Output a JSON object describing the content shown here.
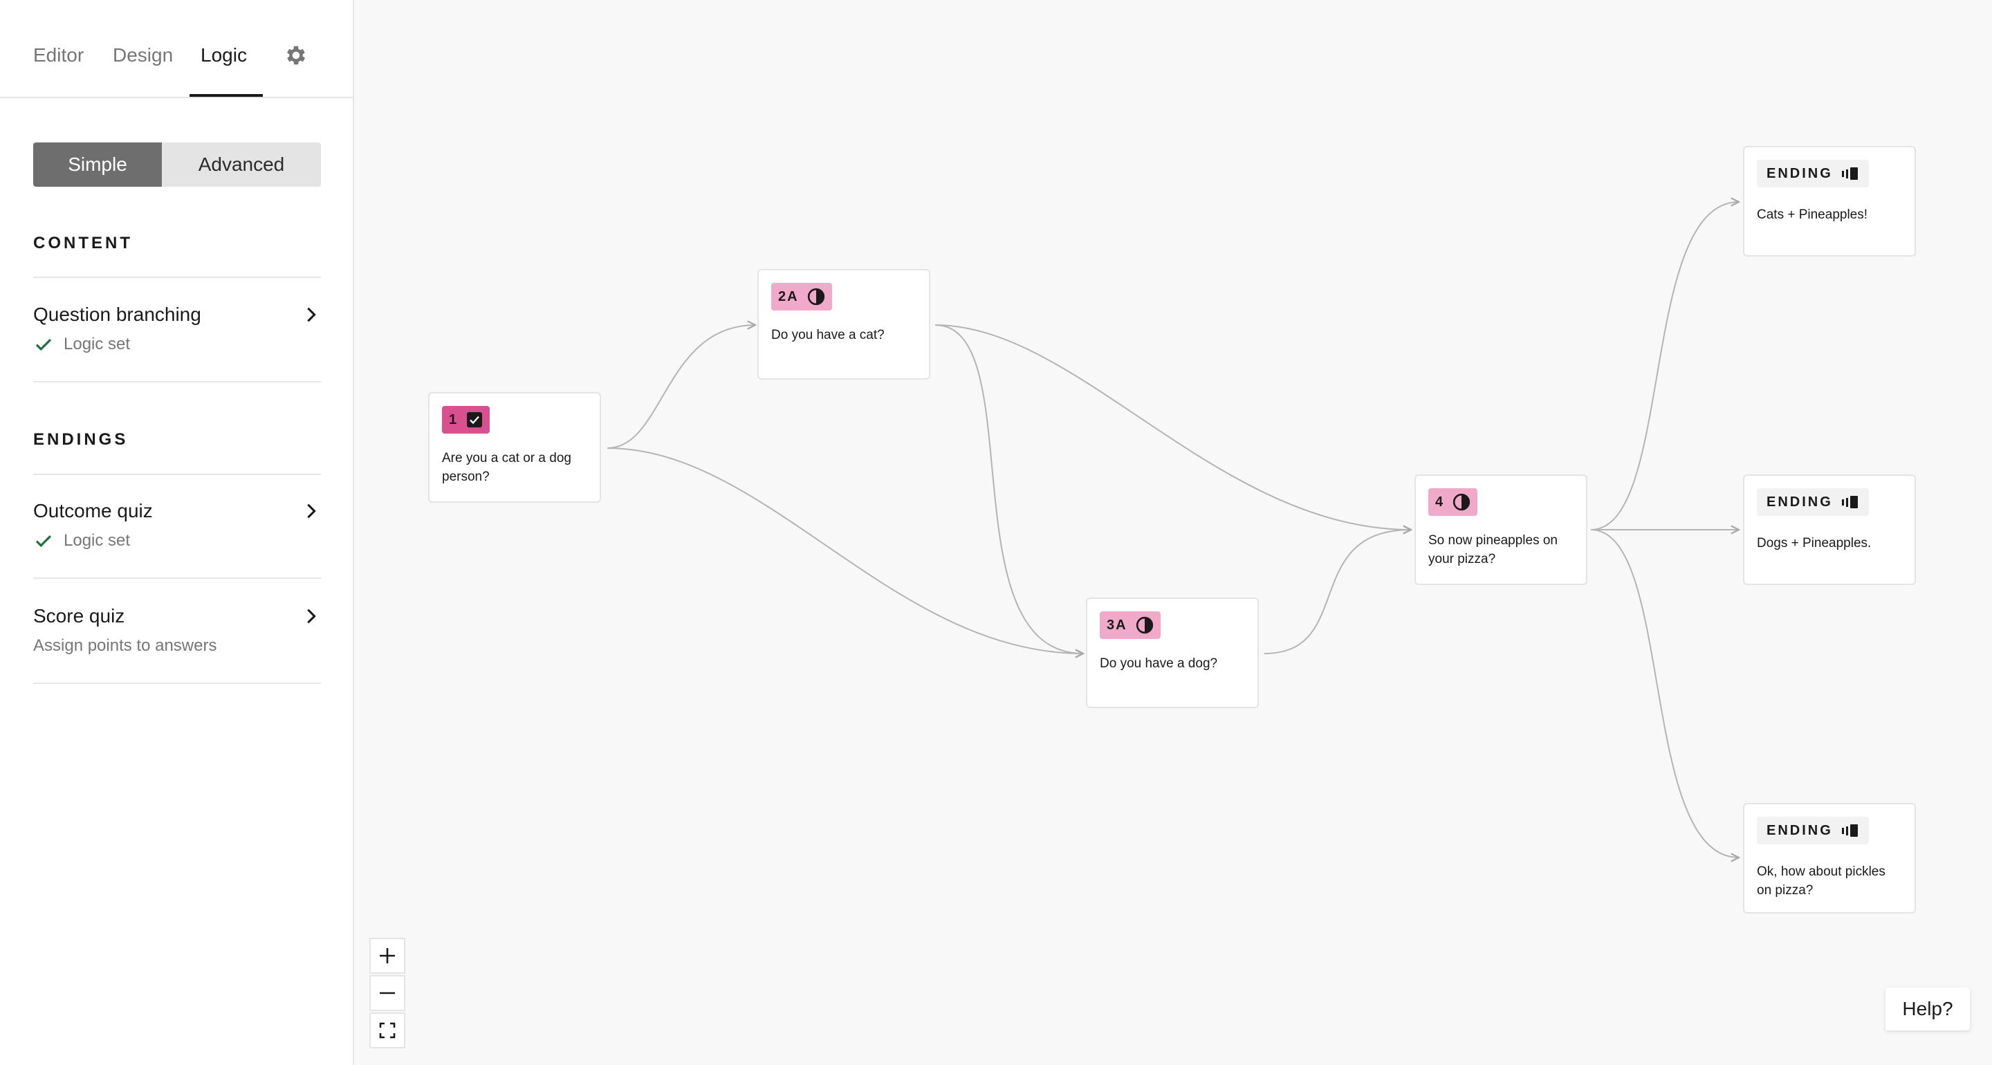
{
  "tabs": {
    "editor": "Editor",
    "design": "Design",
    "logic": "Logic"
  },
  "mode": {
    "simple": "Simple",
    "advanced": "Advanced"
  },
  "content": {
    "heading": "CONTENT",
    "question_branching": {
      "title": "Question branching",
      "status": "Logic set"
    }
  },
  "endings": {
    "heading": "ENDINGS",
    "outcome_quiz": {
      "title": "Outcome quiz",
      "status": "Logic set"
    },
    "score_quiz": {
      "title": "Score quiz",
      "sub": "Assign points to answers"
    }
  },
  "nodes": {
    "q1": {
      "label": "1",
      "text": "Are you a cat or a dog person?"
    },
    "q2a": {
      "label": "2A",
      "text": "Do you have a cat?"
    },
    "q3a": {
      "label": "3A",
      "text": "Do you have a dog?"
    },
    "q4": {
      "label": "4",
      "text": "So now pineapples on your pizza?"
    },
    "end1": {
      "label": "ENDING",
      "text": "Cats + Pineapples!"
    },
    "end2": {
      "label": "ENDING",
      "text": "Dogs + Pineapples."
    },
    "end3": {
      "label": "ENDING",
      "text": "Ok, how about pickles on pizza?"
    }
  },
  "help": "Help?",
  "colors": {
    "accent_dark": "#d94f8f",
    "accent_light": "#f0a9c9",
    "toggle_active": "#6e6e6e"
  }
}
